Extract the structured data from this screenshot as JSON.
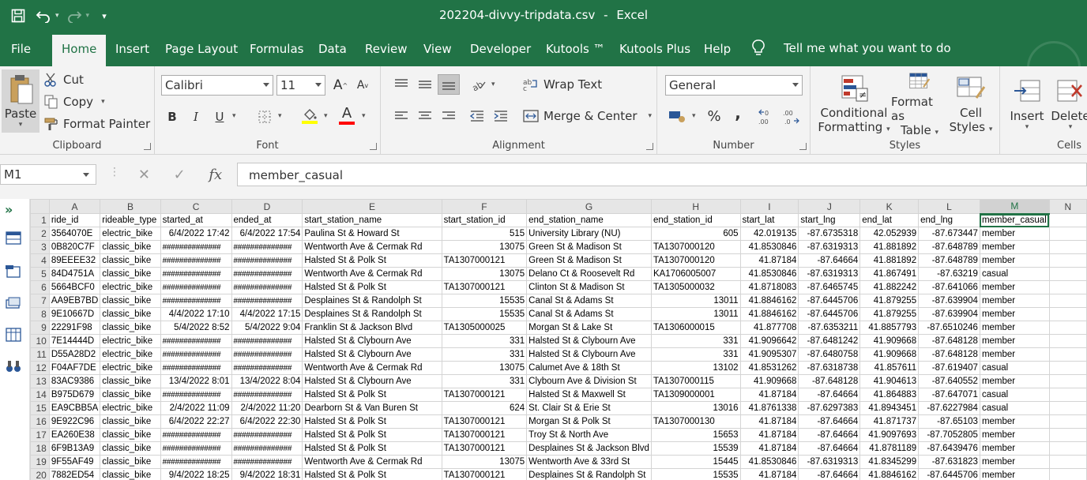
{
  "title_bar": {
    "filename": "202204-divvy-tripdata.csv",
    "separator": "-",
    "app": "Excel"
  },
  "tabs": [
    "File",
    "Home",
    "Insert",
    "Page Layout",
    "Formulas",
    "Data",
    "Review",
    "View",
    "Developer",
    "Kutools ™",
    "Kutools Plus",
    "Help"
  ],
  "active_tab": "Home",
  "tell_me": "Tell me what you want to do",
  "ribbon": {
    "clipboard": {
      "label": "Clipboard",
      "paste": "Paste",
      "cut": "Cut",
      "copy": "Copy",
      "format_painter": "Format Painter"
    },
    "font": {
      "label": "Font",
      "font_name": "Calibri",
      "font_size": "11",
      "bold": "B",
      "italic": "I",
      "underline": "U",
      "font_color_glyph": "A"
    },
    "alignment": {
      "label": "Alignment",
      "wrap_text": "Wrap Text",
      "merge_center": "Merge & Center"
    },
    "number": {
      "label": "Number",
      "format": "General",
      "percent": "%",
      "comma": ","
    },
    "styles": {
      "label": "Styles",
      "conditional": "Conditional",
      "formatting": "Formatting",
      "format_as": "Format as",
      "table": "Table",
      "cell": "Cell",
      "styles_btn": "Styles"
    },
    "cells": {
      "label": "Cells",
      "insert": "Insert",
      "delete": "Delete"
    }
  },
  "formula_bar": {
    "name_box": "M1",
    "fx": "fx",
    "content": "member_casual"
  },
  "sheet": {
    "columns": [
      "A",
      "B",
      "C",
      "D",
      "E",
      "F",
      "G",
      "H",
      "I",
      "J",
      "K",
      "L",
      "M",
      "N"
    ],
    "rows": [
      [
        "ride_id",
        "rideable_type",
        "started_at",
        "ended_at",
        "start_station_name",
        "start_station_id",
        "end_station_name",
        "end_station_id",
        "start_lat",
        "start_lng",
        "end_lat",
        "end_lng",
        "member_casual",
        ""
      ],
      [
        "3564070E",
        "electric_bike",
        "6/4/2022 17:42",
        "6/4/2022 17:54",
        "Paulina St & Howard St",
        "515",
        "University Library (NU)",
        "605",
        "42.019135",
        "-87.6735318",
        "42.052939",
        "-87.673447",
        "member",
        ""
      ],
      [
        "0B820C7F",
        "classic_bike",
        "##############",
        "##############",
        "Wentworth Ave & Cermak Rd",
        "13075",
        "Green St & Madison St",
        "TA1307000120",
        "41.8530846",
        "-87.6319313",
        "41.881892",
        "-87.648789",
        "member",
        ""
      ],
      [
        "89EEEE32",
        "classic_bike",
        "##############",
        "##############",
        "Halsted St & Polk St",
        "TA1307000121",
        "Green St & Madison St",
        "TA1307000120",
        "41.87184",
        "-87.64664",
        "41.881892",
        "-87.648789",
        "member",
        ""
      ],
      [
        "84D4751A",
        "classic_bike",
        "##############",
        "##############",
        "Wentworth Ave & Cermak Rd",
        "13075",
        "Delano Ct & Roosevelt Rd",
        "KA1706005007",
        "41.8530846",
        "-87.6319313",
        "41.867491",
        "-87.63219",
        "casual",
        ""
      ],
      [
        "5664BCF0",
        "electric_bike",
        "##############",
        "##############",
        "Halsted St & Polk St",
        "TA1307000121",
        "Clinton St & Madison St",
        "TA1305000032",
        "41.8718083",
        "-87.6465745",
        "41.882242",
        "-87.641066",
        "member",
        ""
      ],
      [
        "AA9EB7BD",
        "classic_bike",
        "##############",
        "##############",
        "Desplaines St & Randolph St",
        "15535",
        "Canal St & Adams St",
        "13011",
        "41.8846162",
        "-87.6445706",
        "41.879255",
        "-87.639904",
        "member",
        ""
      ],
      [
        "9E10667D",
        "classic_bike",
        "4/4/2022 17:10",
        "4/4/2022 17:15",
        "Desplaines St & Randolph St",
        "15535",
        "Canal St & Adams St",
        "13011",
        "41.8846162",
        "-87.6445706",
        "41.879255",
        "-87.639904",
        "member",
        ""
      ],
      [
        "22291F98",
        "classic_bike",
        "5/4/2022 8:52",
        "5/4/2022 9:04",
        "Franklin St & Jackson Blvd",
        "TA1305000025",
        "Morgan St & Lake St",
        "TA1306000015",
        "41.877708",
        "-87.6353211",
        "41.8857793",
        "-87.6510246",
        "member",
        ""
      ],
      [
        "7E14444D",
        "electric_bike",
        "##############",
        "##############",
        "Halsted St & Clybourn Ave",
        "331",
        "Halsted St & Clybourn Ave",
        "331",
        "41.9096642",
        "-87.6481242",
        "41.909668",
        "-87.648128",
        "member",
        ""
      ],
      [
        "D55A28D2",
        "electric_bike",
        "##############",
        "##############",
        "Halsted St & Clybourn Ave",
        "331",
        "Halsted St & Clybourn Ave",
        "331",
        "41.9095307",
        "-87.6480758",
        "41.909668",
        "-87.648128",
        "member",
        ""
      ],
      [
        "F04AF7DE",
        "electric_bike",
        "##############",
        "##############",
        "Wentworth Ave & Cermak Rd",
        "13075",
        "Calumet Ave & 18th St",
        "13102",
        "41.8531262",
        "-87.6318738",
        "41.857611",
        "-87.619407",
        "casual",
        ""
      ],
      [
        "83AC9386",
        "classic_bike",
        "13/4/2022 8:01",
        "13/4/2022 8:04",
        "Halsted St & Clybourn Ave",
        "331",
        "Clybourn Ave & Division St",
        "TA1307000115",
        "41.909668",
        "-87.648128",
        "41.904613",
        "-87.640552",
        "member",
        ""
      ],
      [
        "B975D679",
        "classic_bike",
        "##############",
        "##############",
        "Halsted St & Polk St",
        "TA1307000121",
        "Halsted St & Maxwell St",
        "TA1309000001",
        "41.87184",
        "-87.64664",
        "41.864883",
        "-87.647071",
        "casual",
        ""
      ],
      [
        "EA9CBB5A",
        "electric_bike",
        "2/4/2022 11:09",
        "2/4/2022 11:20",
        "Dearborn St & Van Buren St",
        "624",
        "St. Clair St & Erie St",
        "13016",
        "41.8761338",
        "-87.6297383",
        "41.8943451",
        "-87.6227984",
        "casual",
        ""
      ],
      [
        "9E922C96",
        "classic_bike",
        "6/4/2022 22:27",
        "6/4/2022 22:30",
        "Halsted St & Polk St",
        "TA1307000121",
        "Morgan St & Polk St",
        "TA1307000130",
        "41.87184",
        "-87.64664",
        "41.871737",
        "-87.65103",
        "member",
        ""
      ],
      [
        "EA260E38",
        "classic_bike",
        "##############",
        "##############",
        "Halsted St & Polk St",
        "TA1307000121",
        "Troy St & North Ave",
        "15653",
        "41.87184",
        "-87.64664",
        "41.9097693",
        "-87.7052805",
        "member",
        ""
      ],
      [
        "6F9B13A9",
        "classic_bike",
        "##############",
        "##############",
        "Halsted St & Polk St",
        "TA1307000121",
        "Desplaines St & Jackson Blvd",
        "15539",
        "41.87184",
        "-87.64664",
        "41.8781189",
        "-87.6439476",
        "member",
        ""
      ],
      [
        "9F55AF49",
        "classic_bike",
        "##############",
        "##############",
        "Wentworth Ave & Cermak Rd",
        "13075",
        "Wentworth Ave & 33rd St",
        "15445",
        "41.8530846",
        "-87.6319313",
        "41.8345299",
        "-87.631823",
        "member",
        ""
      ],
      [
        "7882ED54",
        "classic_bike",
        "9/4/2022 18:25",
        "9/4/2022 18:31",
        "Halsted St & Polk St",
        "TA1307000121",
        "Desplaines St & Randolph St",
        "15535",
        "41.87184",
        "-87.64664",
        "41.8846162",
        "-87.6445706",
        "member",
        ""
      ]
    ]
  }
}
